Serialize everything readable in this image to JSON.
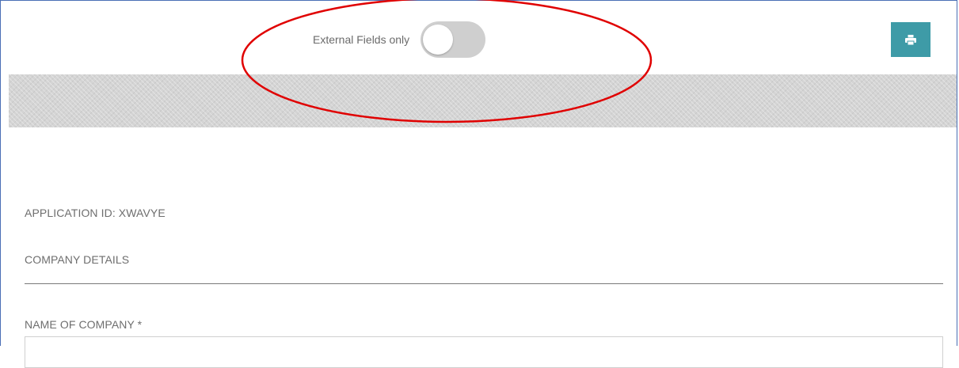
{
  "toolbar": {
    "toggle_label": "External Fields only",
    "toggle_state": "off",
    "print_icon": "print-icon",
    "print_button_color": "#3e9ba7"
  },
  "form": {
    "application_id": "APPLICATION ID: XWAVYE",
    "section_title": "COMPANY DETAILS",
    "company_name_label": "NAME OF COMPANY *",
    "company_name_value": ""
  },
  "annotation": {
    "shape": "ellipse",
    "color": "#e00000",
    "target": "external-fields-toggle"
  }
}
